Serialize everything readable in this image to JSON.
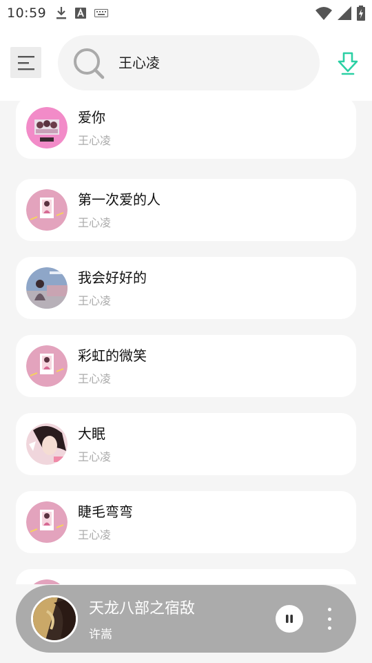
{
  "status_bar": {
    "time": "10:59",
    "left_icons": [
      "download-icon",
      "font-a-icon",
      "keyboard-icon"
    ],
    "right_icons": [
      "wifi-icon",
      "signal-icon",
      "battery-charging-icon"
    ]
  },
  "header": {
    "menu_icon": "menu-lines-icon",
    "search": {
      "icon": "search-icon",
      "query": "王心凌"
    },
    "download_icon": "download-arrow-icon",
    "accent_color": "#2bd0a4"
  },
  "songs": [
    {
      "title": "爱你",
      "artist": "王心凌",
      "cover": "pink-collage"
    },
    {
      "title": "第一次爱的人",
      "artist": "王心凌",
      "cover": "pink-portrait"
    },
    {
      "title": "我会好好的",
      "artist": "王心凌",
      "cover": "blue-scene"
    },
    {
      "title": "彩虹的微笑",
      "artist": "王心凌",
      "cover": "pink-portrait"
    },
    {
      "title": "大眠",
      "artist": "王心凌",
      "cover": "dark-portrait"
    },
    {
      "title": "睫毛弯弯",
      "artist": "王心凌",
      "cover": "pink-portrait"
    },
    {
      "title": "",
      "artist": "",
      "cover": "pink-portrait"
    }
  ],
  "player": {
    "title": "天龙八部之宿敌",
    "artist": "许嵩",
    "pause_icon": "pause-icon",
    "more_icon": "more-vertical-icon"
  }
}
